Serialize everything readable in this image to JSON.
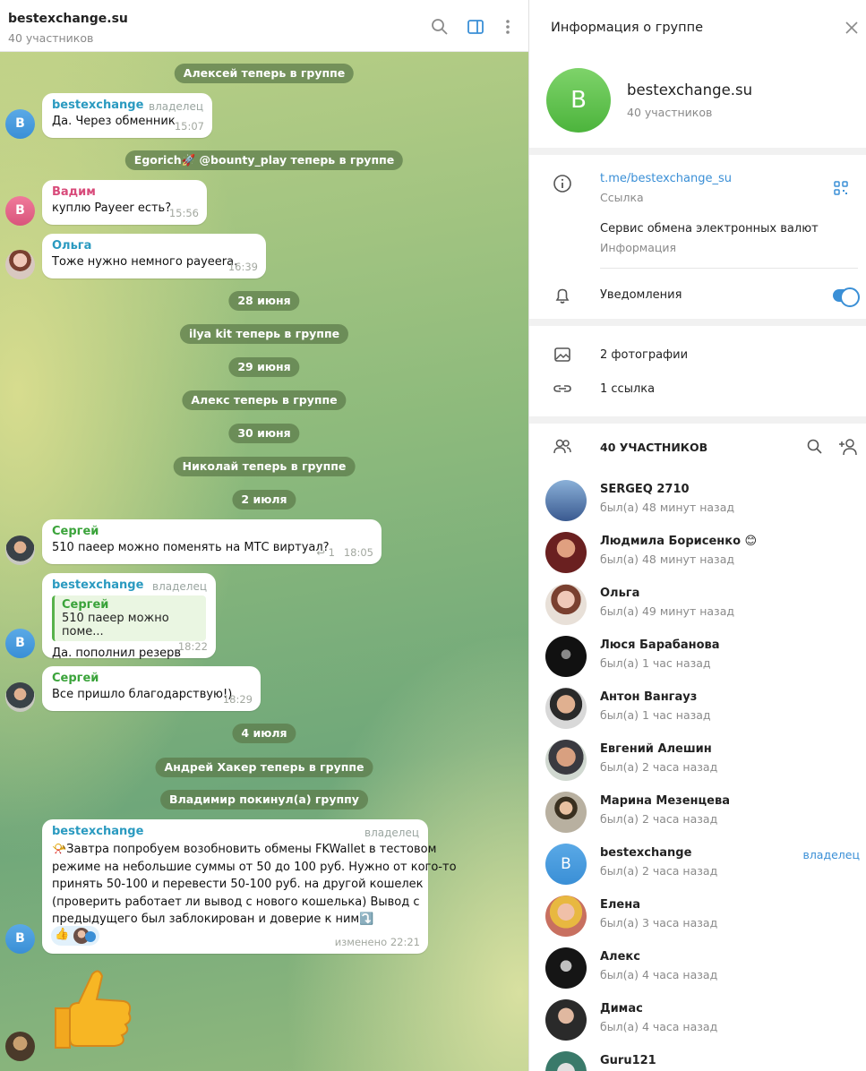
{
  "chat": {
    "title": "bestexchange.su",
    "subtitle": "40 участников",
    "service": {
      "s1": "Алексей теперь в группе",
      "s2": "Egorich🚀 @bounty_play теперь в группе",
      "s3": "28 июня",
      "s4": "ilya kit теперь в группе",
      "s5": "29 июня",
      "s6": "Алекс теперь в группе",
      "s7": "30 июня",
      "s8": "Николай теперь в группе",
      "s9": "2 июля",
      "s10": "4 июля",
      "s11": "Андрей Хакер теперь в группе",
      "s12": "Владимир покинул(а) группу"
    },
    "messages": [
      {
        "author": "bestexchange",
        "role": "владелец",
        "text": "Да. Через обменник",
        "time": "15:07",
        "avatar": "B"
      },
      {
        "author": "Вадим",
        "text": "куплю Payeer есть?",
        "time": "15:56",
        "avatar": "B"
      },
      {
        "author": "Ольга",
        "text": "Тоже нужно немного payeera.",
        "time": "16:39"
      },
      {
        "author": "Сергей",
        "text": "510 паеер можно поменять на МТС виртуал?",
        "replies": "1",
        "time": "18:05"
      },
      {
        "author": "bestexchange",
        "role": "владелец",
        "reply_author": "Сергей",
        "reply_text": "510 паеер можно поме...",
        "text": "Да. пополнил резерв",
        "time": "18:22",
        "avatar": "B"
      },
      {
        "author": "Сергей",
        "text": "Все пришло благодарствую!)",
        "time": "18:29"
      },
      {
        "author": "bestexchange",
        "role": "владелец",
        "line1": "📯Завтра попробуем возобновить обмены FKWallet в тестовом",
        "line2": "режиме на небольшие суммы от 50 до 100 руб. Нужно от кого-то",
        "line3": "принять 50-100 и перевести 50-100 руб. на другой кошелек",
        "line4": "(проверить работает ли вывод с нового кошелька) Вывод с",
        "line5": "предыдущего был заблокирован и доверие к ним⤵️",
        "reaction": "👍",
        "time": "изменено 22:21",
        "avatar": "B"
      }
    ]
  },
  "panel": {
    "title": "Информация о группе",
    "group_name": "bestexchange.su",
    "group_avatar": "B",
    "group_sub": "40 участников",
    "link": "t.me/bestexchange_su",
    "link_label": "Ссылка",
    "info": "Сервис обмена электронных валют",
    "info_label": "Информация",
    "notifications": "Уведомления",
    "notifications_on": true,
    "photos": "2 фотографии",
    "links": "1 ссылка",
    "members_header": "40 УЧАСТНИКОВ",
    "members": [
      {
        "name": "SERGEQ 2710",
        "status": "был(а) 48 минут назад"
      },
      {
        "name": "Людмила Борисенко 😊",
        "status": "был(а) 48 минут назад"
      },
      {
        "name": "Ольга",
        "status": "был(а) 49 минут назад"
      },
      {
        "name": "Люся Барабанова",
        "status": "был(а) 1 час назад"
      },
      {
        "name": "Антон Вангауз",
        "status": "был(а) 1 час назад"
      },
      {
        "name": "Евгений Алешин",
        "status": "был(а) 2 часа назад"
      },
      {
        "name": "Марина Мезенцева",
        "status": "был(а) 2 часа назад"
      },
      {
        "name": "bestexchange",
        "status": "был(а) 2 часа назад",
        "role": "владелец",
        "avatar": "B"
      },
      {
        "name": "Елена",
        "status": "был(а) 3 часа назад"
      },
      {
        "name": "Алекс",
        "status": "был(а) 4 часа назад"
      },
      {
        "name": "Димас",
        "status": "был(а) 4 часа назад"
      },
      {
        "name": "Guru121",
        "status": ""
      }
    ]
  },
  "colors": {
    "accent": "#3a8fd6",
    "green": "#3aa33a",
    "pink": "#d84a7a"
  }
}
